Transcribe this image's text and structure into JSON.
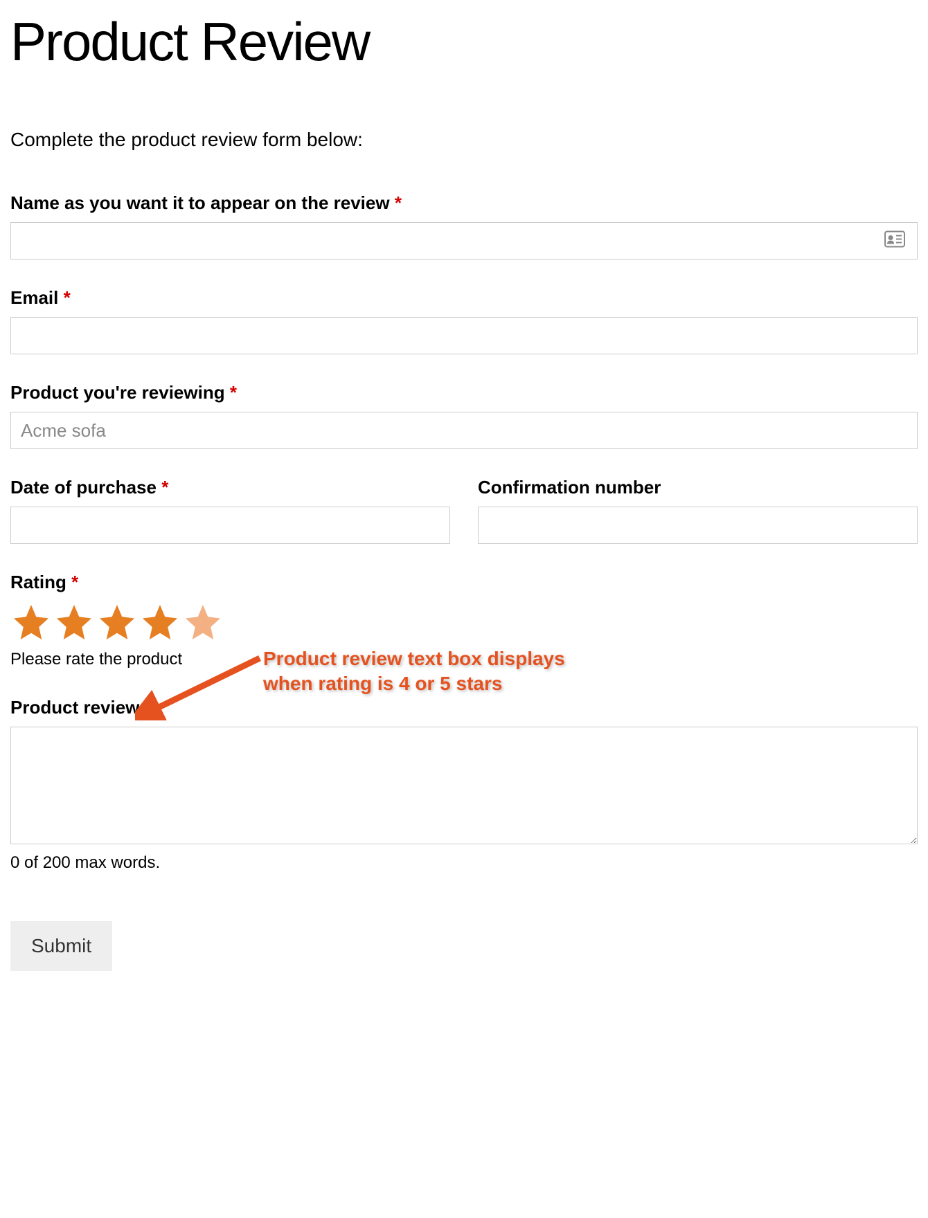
{
  "page": {
    "title": "Product Review",
    "intro": "Complete the product review form below:"
  },
  "fields": {
    "name": {
      "label": "Name as you want it to appear on the review",
      "required": "*",
      "value": ""
    },
    "email": {
      "label": "Email",
      "required": "*",
      "value": ""
    },
    "product": {
      "label": "Product you're reviewing",
      "required": "*",
      "placeholder": "Acme sofa",
      "value": ""
    },
    "date": {
      "label": "Date of purchase",
      "required": "*",
      "value": ""
    },
    "confirmation": {
      "label": "Confirmation number",
      "value": ""
    },
    "rating": {
      "label": "Rating",
      "required": "*",
      "helper": "Please rate the product",
      "selected": 4,
      "hover": 5
    },
    "review": {
      "label": "Product review",
      "value": "",
      "word_count": "0 of 200 max words."
    }
  },
  "annotation": {
    "line1": "Product review text box displays",
    "line2": "when rating is 4 or 5 stars"
  },
  "actions": {
    "submit": "Submit"
  }
}
